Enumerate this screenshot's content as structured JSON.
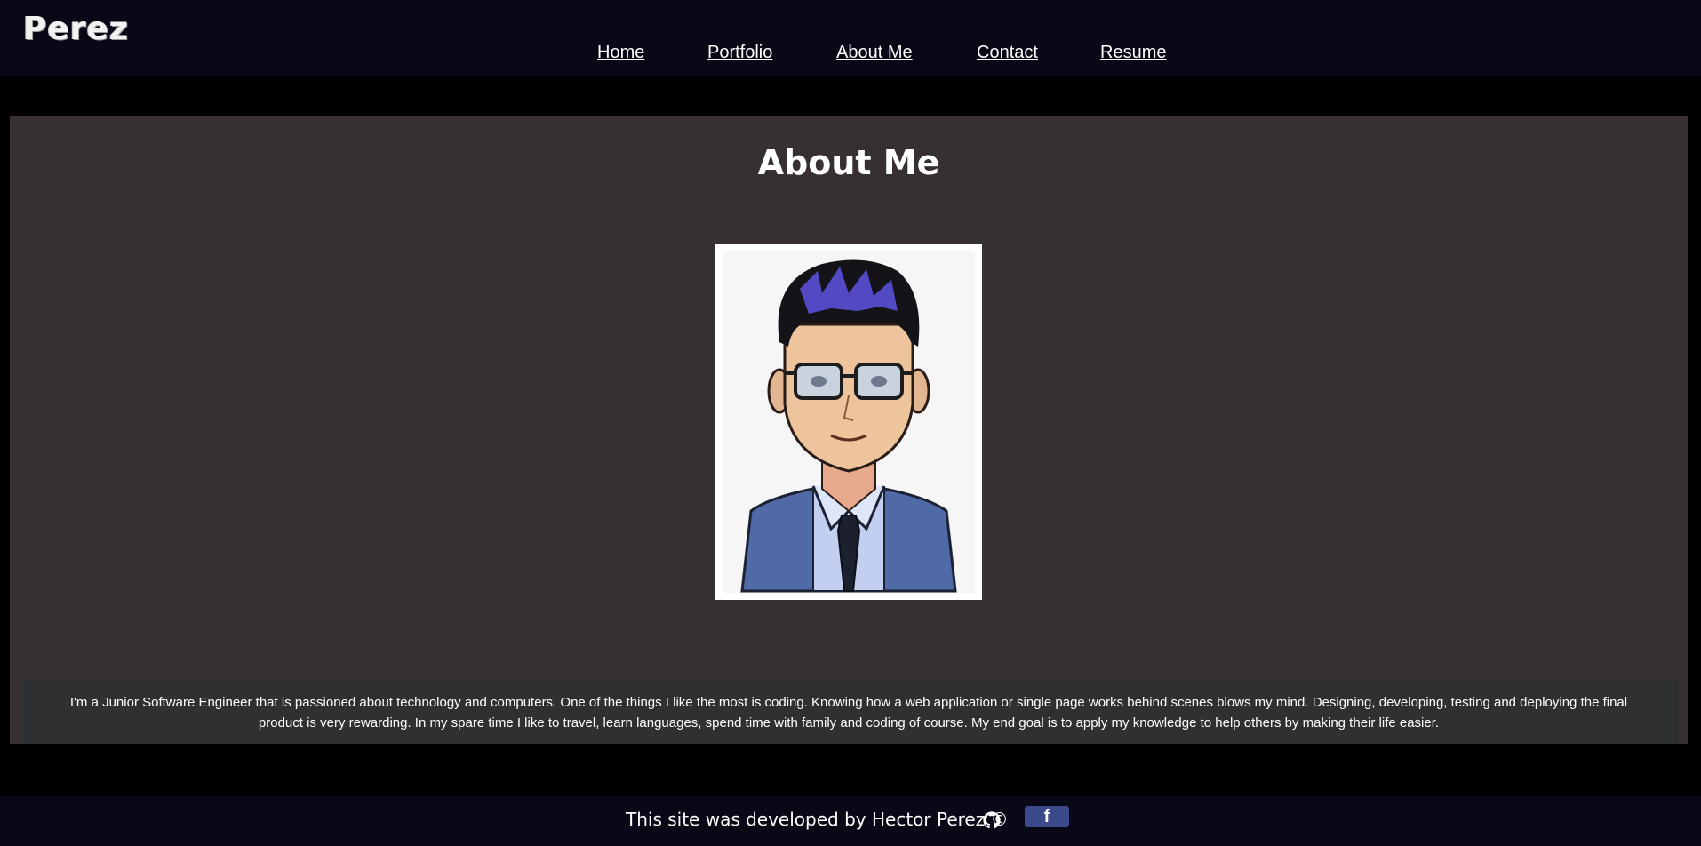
{
  "header": {
    "logo": "Perez",
    "nav": [
      {
        "label": "Home"
      },
      {
        "label": "Portfolio"
      },
      {
        "label": "About Me"
      },
      {
        "label": "Contact"
      },
      {
        "label": "Resume"
      }
    ]
  },
  "about": {
    "title": "About Me",
    "image_icon": "cartoon-avatar-portrait",
    "bio": "I'm a Junior Software Engineer that is passioned about technology and computers. One of the things I like the most is coding. Knowing how a web application or single page works behind scenes blows my mind. Designing, developing, testing and deploying the final product is very rewarding. In my spare time I like to travel, learn languages, spend time with family and coding of course. My end goal is to apply my knowledge to help others by making their life easier."
  },
  "footer": {
    "text": "This site was developed by Hector Perez ©",
    "github_icon": "github-icon",
    "facebook_label": "f"
  },
  "colors": {
    "header_bg": "#090817",
    "page_bg": "#000000",
    "section_bg": "#363031",
    "bio_bg": "#2e3031",
    "facebook_bg": "#3c4a8c"
  }
}
